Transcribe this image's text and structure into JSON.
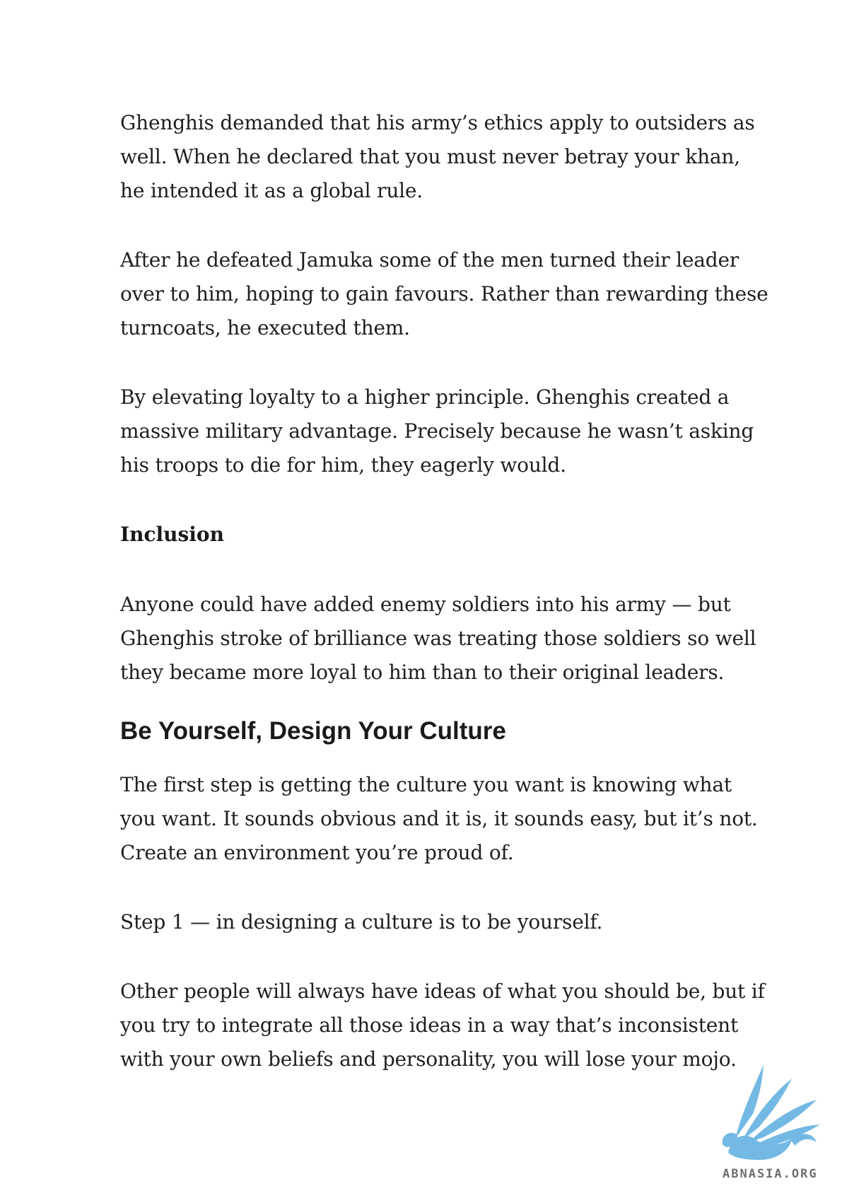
{
  "paragraphs": {
    "p1": [
      "Ghenghis demanded that his army’s ethics apply to outsiders as",
      "well. When he declared that you must never betray your khan,",
      "he intended it as a global rule."
    ],
    "p2": [
      "After he defeated Jamuka some of the men turned their leader",
      "over to him, hoping to gain favours. Rather than rewarding these",
      "turncoats, he executed them."
    ],
    "p3": [
      "By elevating loyalty to a higher principle. Ghenghis created a",
      "massive military advantage. Precisely because he wasn’t asking",
      "his troops to die for him, they eagerly would."
    ],
    "subheading": "Inclusion",
    "p4": [
      "Anyone could have added enemy soldiers into his army — but",
      "Ghenghis stroke of brilliance was treating those soldiers so well",
      "they became more loyal to him than to their original leaders."
    ],
    "heading": "Be Yourself, Design Your Culture",
    "p5": [
      "The first step is getting the culture you want is knowing what",
      "you want. It sounds obvious and it is, it sounds easy, but it’s not.",
      "Create an environment you’re proud of."
    ],
    "p6": [
      "Step 1 — in designing a culture is to be yourself."
    ],
    "p7": [
      "Other people will always have ideas of what you should be, but if",
      "you try to integrate all those ideas in a way that’s inconsistent",
      "with your own beliefs and personality, you will lose your mojo."
    ]
  },
  "watermark": {
    "text": "ABNASIA.ORG",
    "icon": "griffin-logo-icon",
    "color": "#6fb6e3"
  }
}
